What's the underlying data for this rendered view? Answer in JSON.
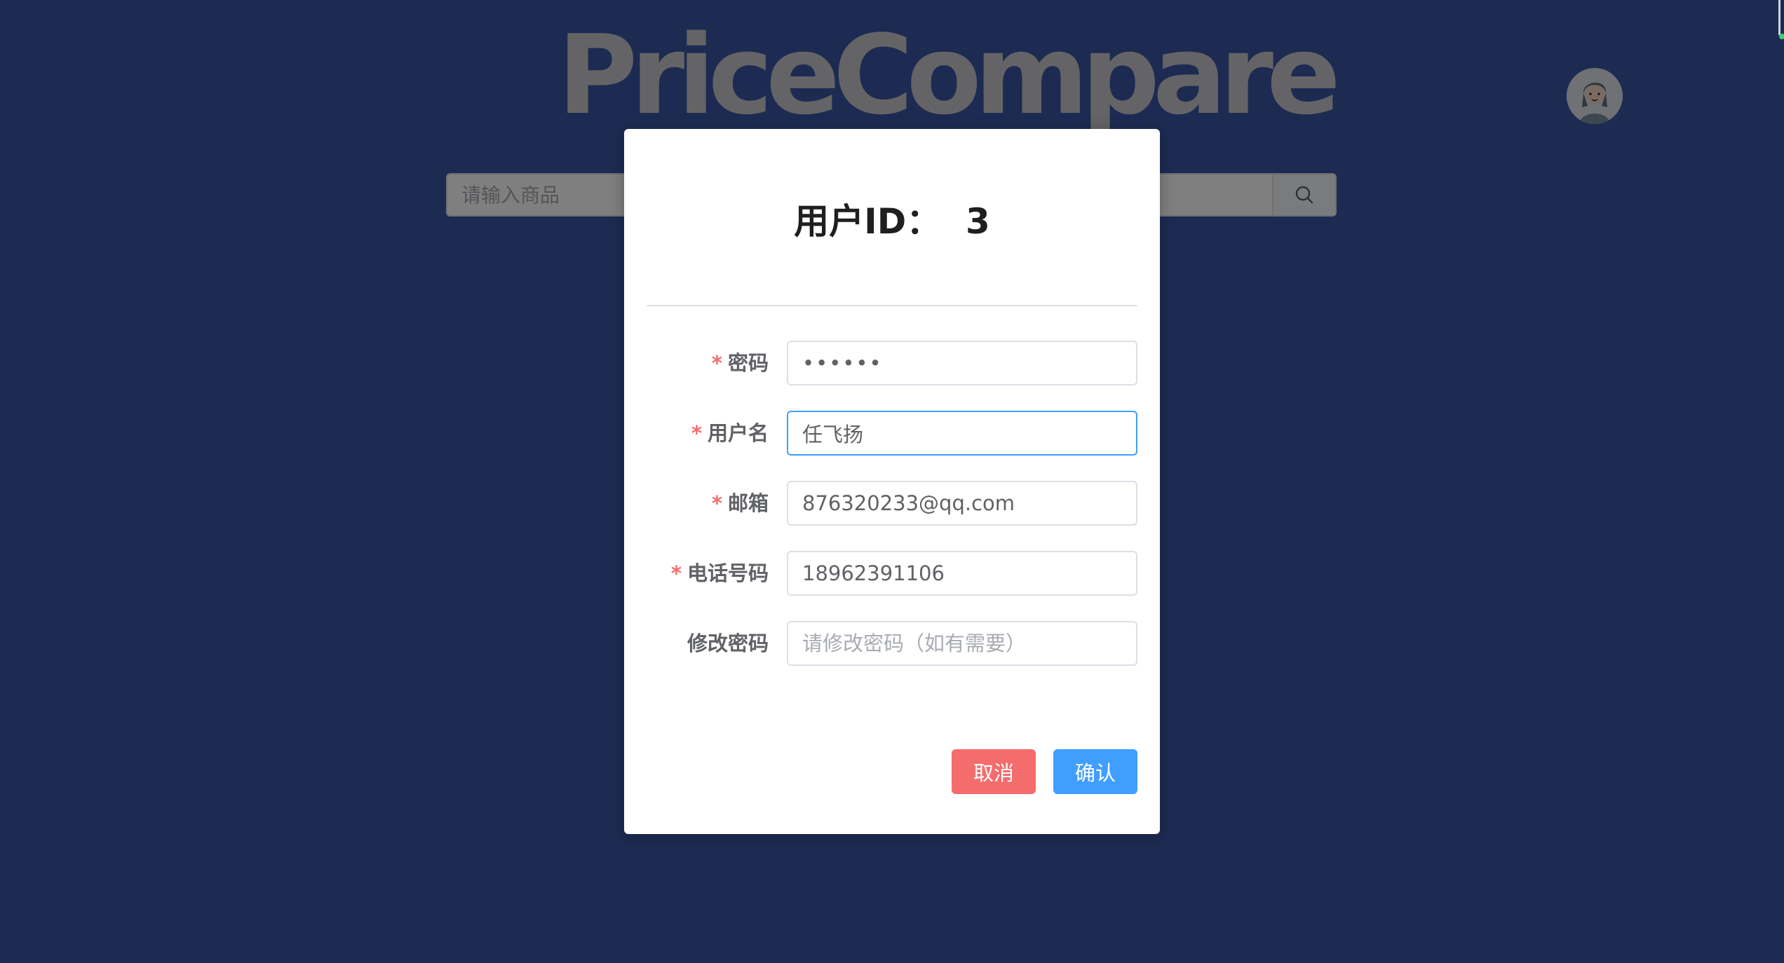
{
  "app": {
    "logo_text": "PriceCompare",
    "search": {
      "placeholder": "请输入商品",
      "value": ""
    },
    "search_icon": "search-icon",
    "avatar_icon": "user-avatar"
  },
  "dialog": {
    "title": "用户ID：  3",
    "fields": [
      {
        "label": "密码",
        "required": true,
        "value": "••••••",
        "placeholder": ""
      },
      {
        "label": "用户名",
        "required": true,
        "value": "任飞扬",
        "placeholder": ""
      },
      {
        "label": "邮箱",
        "required": true,
        "value": "876320233@qq.com",
        "placeholder": ""
      },
      {
        "label": "电话号码",
        "required": true,
        "value": "18962391106",
        "placeholder": ""
      },
      {
        "label": "修改密码",
        "required": false,
        "value": "",
        "placeholder": "请修改密码（如有需要）"
      }
    ],
    "required_mark": "*",
    "cancel_label": "取消",
    "confirm_label": "确认"
  },
  "colors": {
    "page_bg": "#3a57a6",
    "required": "#f56c6c",
    "cancel": "#f56c6c",
    "confirm": "#409eff",
    "focus_border": "#409eff"
  }
}
